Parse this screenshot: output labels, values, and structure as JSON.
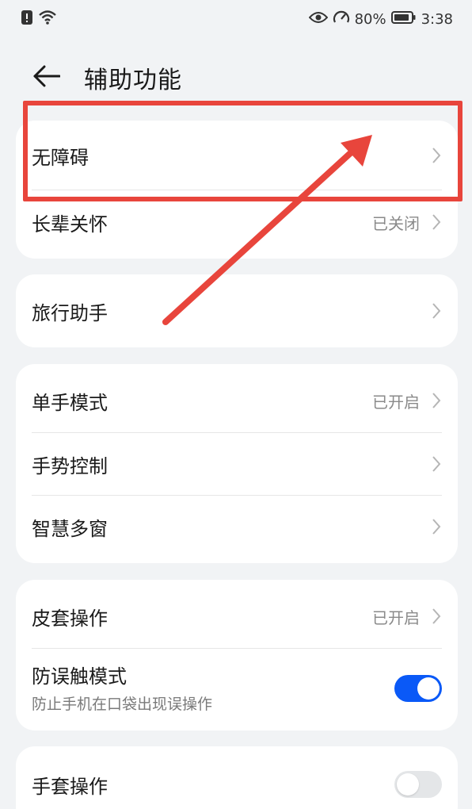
{
  "status_bar": {
    "battery_percent": "80%",
    "time": "3:38",
    "icons": [
      "alert-icon",
      "wifi-icon",
      "eye-comfort-icon",
      "speed-icon",
      "battery-icon"
    ]
  },
  "header": {
    "title": "辅助功能",
    "back_icon": "back-arrow-icon"
  },
  "groups": [
    {
      "items": [
        {
          "label": "无障碍",
          "value": "",
          "chevron": true
        },
        {
          "label": "长辈关怀",
          "value": "已关闭",
          "chevron": true
        }
      ]
    },
    {
      "items": [
        {
          "label": "旅行助手",
          "value": "",
          "chevron": true
        }
      ]
    },
    {
      "items": [
        {
          "label": "单手模式",
          "value": "已开启",
          "chevron": true
        },
        {
          "label": "手势控制",
          "value": "",
          "chevron": true
        },
        {
          "label": "智慧多窗",
          "value": "",
          "chevron": true
        }
      ]
    },
    {
      "items": [
        {
          "label": "皮套操作",
          "value": "已开启",
          "chevron": true
        },
        {
          "label": "防误触模式",
          "subtitle": "防止手机在口袋出现误操作",
          "toggle": true
        }
      ]
    },
    {
      "items": [
        {
          "label": "手套操作",
          "toggle": false
        }
      ]
    }
  ],
  "colors": {
    "accent": "#0a59f7",
    "annotation": "#e8453c",
    "background": "#f1f3f5",
    "card": "#ffffff"
  }
}
